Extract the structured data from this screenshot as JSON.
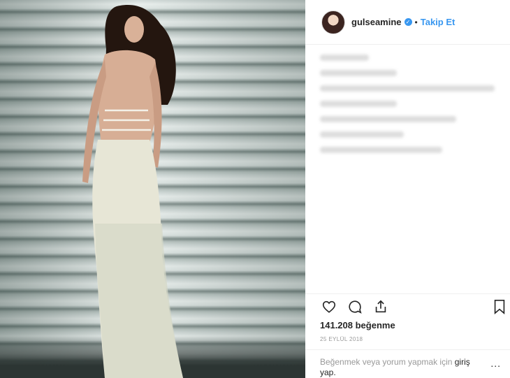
{
  "post": {
    "username": "gulseamine",
    "follow_label": "Takip Et",
    "separator": "•",
    "likes": "141.208 beğenme",
    "date": "25 EYLÜL 2018",
    "footer_prefix": "Beğenmek veya yorum yapmak için ",
    "footer_link": "giriş",
    "footer_suffix": "yap.",
    "more_label": "..."
  },
  "icons": {
    "verified": "verified-badge-icon",
    "like": "heart-icon",
    "comment": "comment-icon",
    "share": "share-icon",
    "save": "bookmark-icon"
  },
  "colors": {
    "link": "#3897f0",
    "text": "#262626",
    "muted": "#999999"
  }
}
